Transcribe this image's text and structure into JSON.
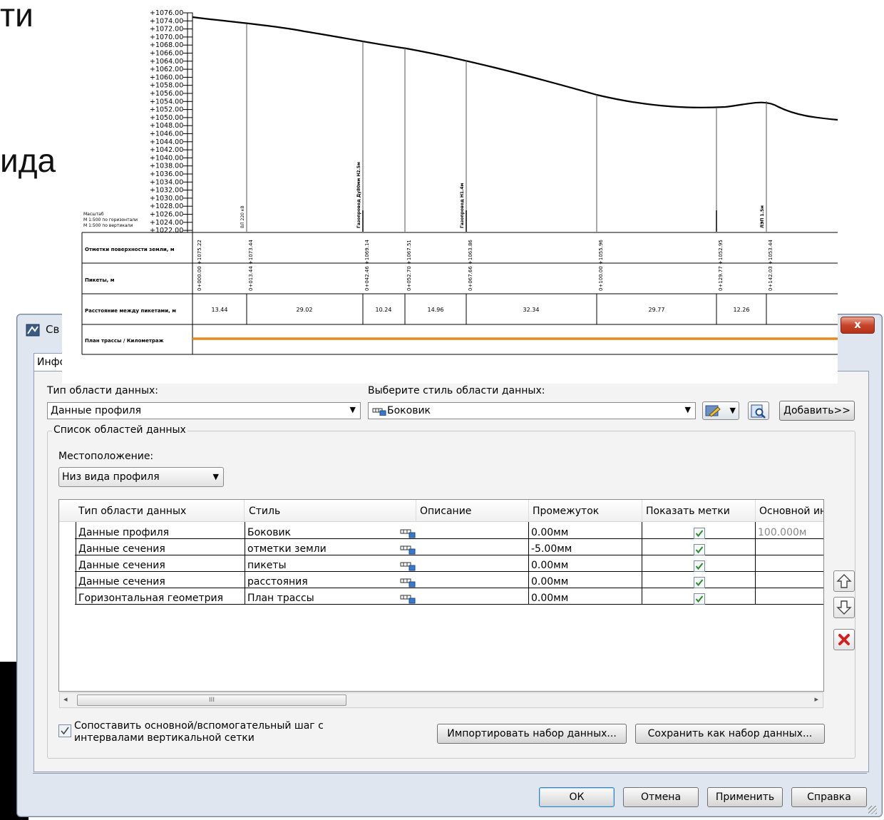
{
  "background": {
    "fragment_top": "ти",
    "fragment_mid": "ида"
  },
  "profile_drawing": {
    "elevation_labels": [
      "+1076.00",
      "+1074.00",
      "+1072.00",
      "+1070.00",
      "+1068.00",
      "+1066.00",
      "+1064.00",
      "+1062.00",
      "+1060.00",
      "+1058.00",
      "+1056.00",
      "+1054.00",
      "+1052.00",
      "+1050.00",
      "+1048.00",
      "+1046.00",
      "+1044.00",
      "+1042.00",
      "+1040.00",
      "+1038.00",
      "+1036.00",
      "+1034.00",
      "+1032.00",
      "+1030.00",
      "+1028.00",
      "+1026.00",
      "+1024.00",
      "+1022.00"
    ],
    "scale_note": [
      "Масштаб",
      "М 1:500 по горизонтали",
      "М 1:500 по вертикали"
    ],
    "band_titles": [
      "Отметки поверхности земли, м",
      "Пикеты, м",
      "Расстояние между пикетами, м",
      "План трассы / Километраж"
    ],
    "station_labels": [
      "0+000.00 +1075.22",
      "0+013.44 +1073.44",
      "0+042.46 +1069.14",
      "0+052.70 +1067.51",
      "0+067.66 +1063.86",
      "0+100.00 +1055.96",
      "0+129.77 +1052.95",
      "0+142.03 +1053.44"
    ],
    "distance_labels": [
      "13.44",
      "29.02",
      "10.24",
      "14.96",
      "32.34",
      "29.77",
      "12.26"
    ]
  },
  "dialog": {
    "title": "Св",
    "close_label": "x",
    "tab_label": "Инфо",
    "data_type_label": "Тип области данных:",
    "data_type_value": "Данные профиля",
    "style_label": "Выберите стиль области данных:",
    "style_value": "Боковик",
    "add_button": "Добавить>>",
    "list_group_label": "Список областей данных",
    "location_label": "Местоположение:",
    "location_value": "Низ вида профиля",
    "columns": [
      "Тип области данных",
      "Стиль",
      "Описание",
      "Промежуток",
      "Показать метки",
      "Основной ин"
    ],
    "rows": [
      {
        "type": "Данные профиля",
        "style": "Боковик",
        "description": "",
        "gap": "0.00мм",
        "show_labels": true,
        "base": "100.000м"
      },
      {
        "type": "Данные сечения",
        "style": "отметки земли",
        "description": "",
        "gap": "-5.00мм",
        "show_labels": true,
        "base": ""
      },
      {
        "type": "Данные сечения",
        "style": "пикеты",
        "description": "",
        "gap": "0.00мм",
        "show_labels": true,
        "base": ""
      },
      {
        "type": "Данные сечения",
        "style": "расстояния",
        "description": "",
        "gap": "0.00мм",
        "show_labels": true,
        "base": ""
      },
      {
        "type": "Горизонтальная геометрия",
        "style": "План трассы",
        "description": "",
        "gap": "0.00мм",
        "show_labels": true,
        "base": ""
      }
    ],
    "scroll_thumb_glyph": "III",
    "match_checkbox_label": "Сопоставить основной/вспомогательный шаг с интервалами вертикальной сетки",
    "import_button": "Импортировать набор данных...",
    "save_button": "Сохранить как набор данных...",
    "ok_button": "ОК",
    "cancel_button": "Отмена",
    "apply_button": "Применить",
    "help_button": "Справка"
  }
}
